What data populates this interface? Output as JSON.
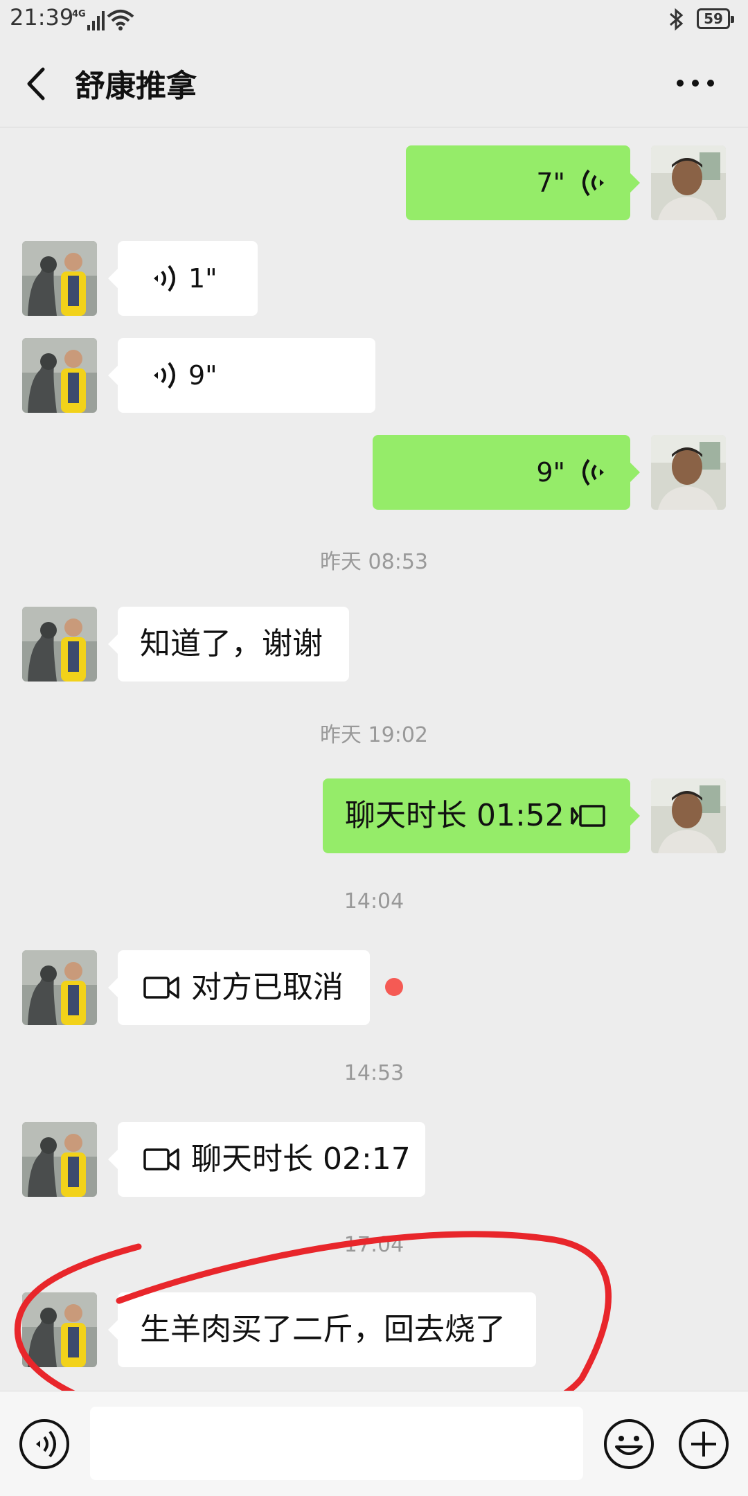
{
  "status_bar": {
    "time": "21:39",
    "network": "4G",
    "battery": "59"
  },
  "header": {
    "title": "舒康推拿"
  },
  "messages": [
    {
      "type": "voice_out",
      "duration": "7\""
    },
    {
      "type": "voice_in",
      "duration": "1\""
    },
    {
      "type": "voice_in",
      "duration": "9\""
    },
    {
      "type": "voice_out",
      "duration": "9\""
    },
    {
      "type": "timestamp",
      "text": "昨天 08:53"
    },
    {
      "type": "text_in",
      "text": "知道了，谢谢"
    },
    {
      "type": "timestamp",
      "text": "昨天 19:02"
    },
    {
      "type": "call_out",
      "text": "聊天时长 01:52"
    },
    {
      "type": "timestamp",
      "text": "14:04"
    },
    {
      "type": "video_in",
      "text": "对方已取消"
    },
    {
      "type": "timestamp",
      "text": "14:53"
    },
    {
      "type": "video_in",
      "text": "聊天时长 02:17"
    },
    {
      "type": "timestamp",
      "text": "17:04"
    },
    {
      "type": "text_in",
      "text": "生羊肉买了二斤，回去烧了"
    }
  ],
  "colors": {
    "outgoing_bubble": "#95ec69",
    "incoming_bubble": "#ffffff",
    "background": "#ededed",
    "annotation": "#e8262b",
    "unread_dot": "#f55a54"
  },
  "icons": [
    "back-icon",
    "more-icon",
    "voice-wave-icon",
    "video-call-icon",
    "voice-call-icon",
    "voice-mode-icon",
    "emoji-icon",
    "plus-icon"
  ]
}
